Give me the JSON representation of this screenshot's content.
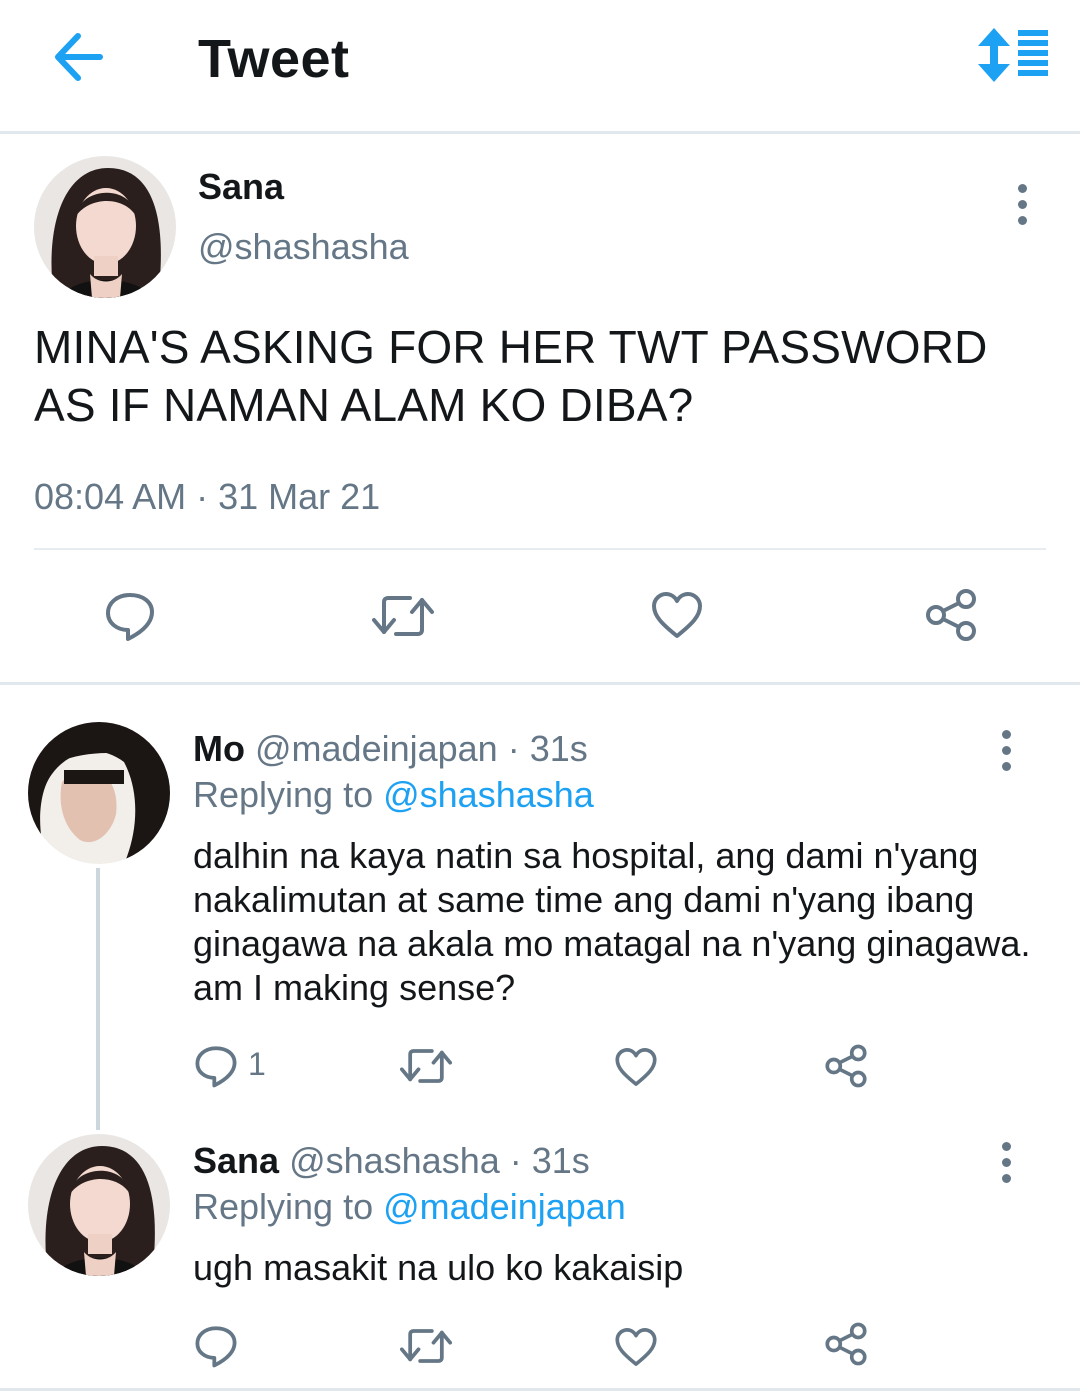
{
  "header": {
    "title": "Tweet",
    "back_icon": "arrow-left-icon",
    "sort_icon": "sort-list-icon",
    "accent": "#1da1f2"
  },
  "main_tweet": {
    "name": "Sana",
    "handle": "@shashasha",
    "text": "MINA'S ASKING FOR HER TWT PASSWORD AS IF NAMAN ALAM KO DIBA?",
    "timestamp": "08:04 AM · 31 Mar 21",
    "actions": [
      "reply-icon",
      "retweet-icon",
      "like-icon",
      "share-icon"
    ]
  },
  "replies": [
    {
      "name": "Mo",
      "handle": "@madeinjapan",
      "sep": " · ",
      "time": "31s",
      "replying_prefix": "Replying to ",
      "replying_to": "@shashasha",
      "text": "dalhin na kaya natin sa hospital, ang dami n'yang nakalimutan at same time ang dami n'yang ibang ginagawa na akala mo matagal na n'yang ginagawa. am I making sense?",
      "reply_count": "1"
    },
    {
      "name": "Sana",
      "handle": "@shashasha",
      "sep": " · ",
      "time": "31s",
      "replying_prefix": "Replying to ",
      "replying_to": "@madeinjapan",
      "text": "ugh masakit na ulo ko kakaisip",
      "reply_count": ""
    }
  ],
  "colors": {
    "text": "#14171a",
    "muted": "#657786",
    "link": "#1da1f2",
    "divider": "#e1e8ed"
  }
}
